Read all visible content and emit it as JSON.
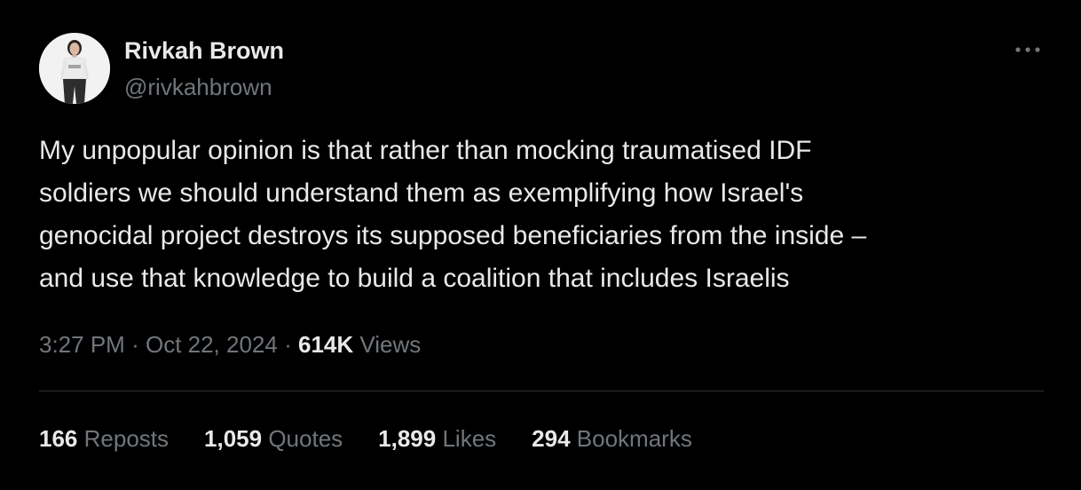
{
  "author": {
    "display_name": "Rivkah Brown",
    "handle": "@rivkahbrown"
  },
  "tweet": {
    "lines": [
      "My unpopular opinion is that rather than mocking traumatised IDF",
      "soldiers we should understand them as exemplifying how Israel's",
      "genocidal project destroys its supposed beneficiaries from the inside –",
      "and use that knowledge to build a coalition that includes Israelis"
    ]
  },
  "meta": {
    "time": "3:27 PM",
    "separator": "·",
    "date": "Oct 22, 2024",
    "views_count": "614K",
    "views_label": "Views"
  },
  "stats": {
    "reposts": {
      "count": "166",
      "label": "Reposts"
    },
    "quotes": {
      "count": "1,059",
      "label": "Quotes"
    },
    "likes": {
      "count": "1,899",
      "label": "Likes"
    },
    "bookmarks": {
      "count": "294",
      "label": "Bookmarks"
    }
  },
  "icons": {
    "more": "more-horizontal-icon",
    "avatar": "profile-photo"
  },
  "colors": {
    "background": "#000000",
    "primary_text": "#e7e9ea",
    "secondary_text": "#71767b",
    "divider": "#2f3336"
  }
}
